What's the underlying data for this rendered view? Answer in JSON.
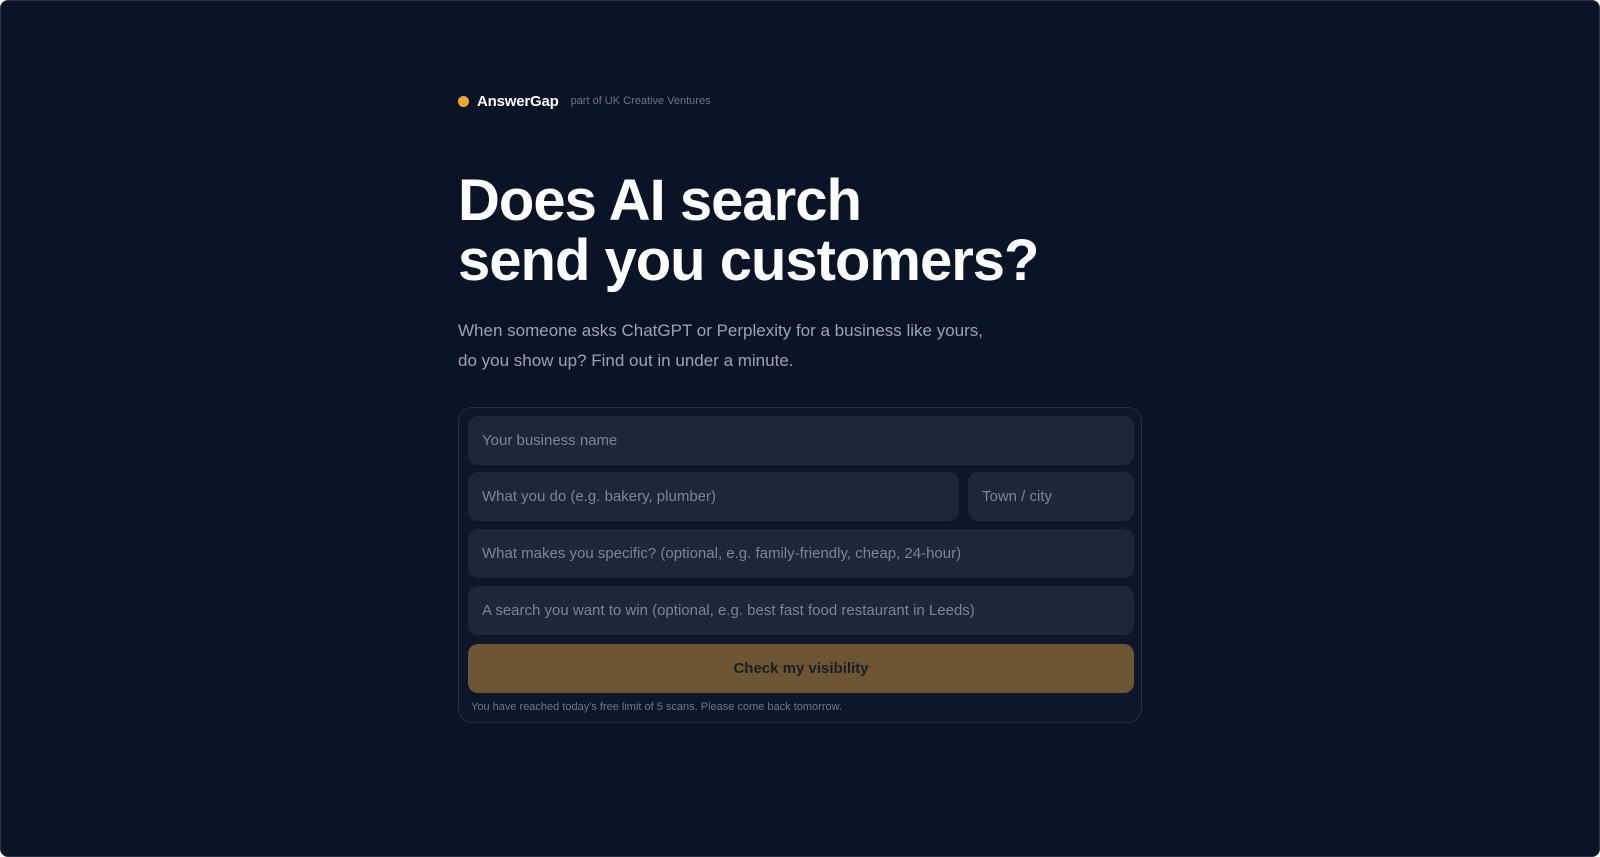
{
  "brand": {
    "name": "AnswerGap",
    "tagline": "part of UK Creative Ventures",
    "dot_color": "#f0a532"
  },
  "hero": {
    "headline_line1": "Does AI search",
    "headline_line2": "send you customers?",
    "sub_line1": "When someone asks ChatGPT or Perplexity for a business like yours,",
    "sub_line2": "do you show up? Find out in under a minute."
  },
  "form": {
    "business_name": {
      "placeholder": "Your business name",
      "value": ""
    },
    "what_you_do": {
      "placeholder": "What you do (e.g. bakery, plumber)",
      "value": ""
    },
    "town": {
      "placeholder": "Town / city",
      "value": ""
    },
    "specific": {
      "placeholder": "What makes you specific? (optional, e.g. family-friendly, cheap, 24-hour)",
      "value": ""
    },
    "search": {
      "placeholder": "A search you want to win (optional, e.g. best fast food restaurant in Leeds)",
      "value": ""
    },
    "submit_label": "Check my visibility",
    "submit_color": "#6d5433",
    "limit_note": "You have reached today's free limit of 5 scans. Please come back tomorrow."
  }
}
